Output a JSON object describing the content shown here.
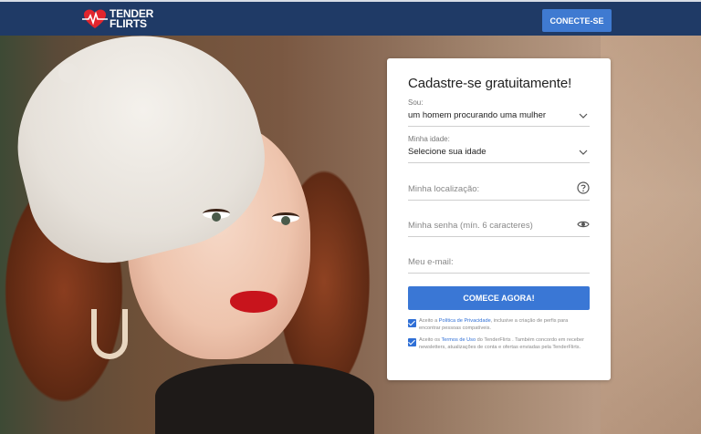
{
  "header": {
    "logo_line1": "TENDER",
    "logo_line2": "FLIRTS",
    "login_label": "CONECTE-SE",
    "brand_color": "#1f3a66",
    "button_color": "#3f7ad1"
  },
  "signup": {
    "title": "Cadastre-se gratuitamente!",
    "seeking": {
      "label": "Sou:",
      "value": "um homem procurando uma mulher"
    },
    "age": {
      "label": "Minha idade:",
      "value": "Selecione sua idade"
    },
    "location": {
      "placeholder": "Minha localização:",
      "icon": "help-icon"
    },
    "password": {
      "placeholder": "Minha senha (mín. 6 caracteres)",
      "icon": "eye-icon"
    },
    "email": {
      "placeholder": "Meu e-mail:"
    },
    "cta_label": "COMECE AGORA!",
    "cta_color": "#3a77d5",
    "consent_privacy": {
      "checked": true,
      "before": "Aceito a ",
      "link": "Política de Privacidade",
      "after": ", inclusive a criação de perfis para encontrar pessoas compatíveis."
    },
    "consent_terms": {
      "checked": true,
      "before": "Aceito os ",
      "link": "Termos de Uso",
      "after": " do TenderFlirts . Também concordo em receber newsletters, atualizações de conta e ofertas enviadas pela TenderFlirts."
    }
  }
}
